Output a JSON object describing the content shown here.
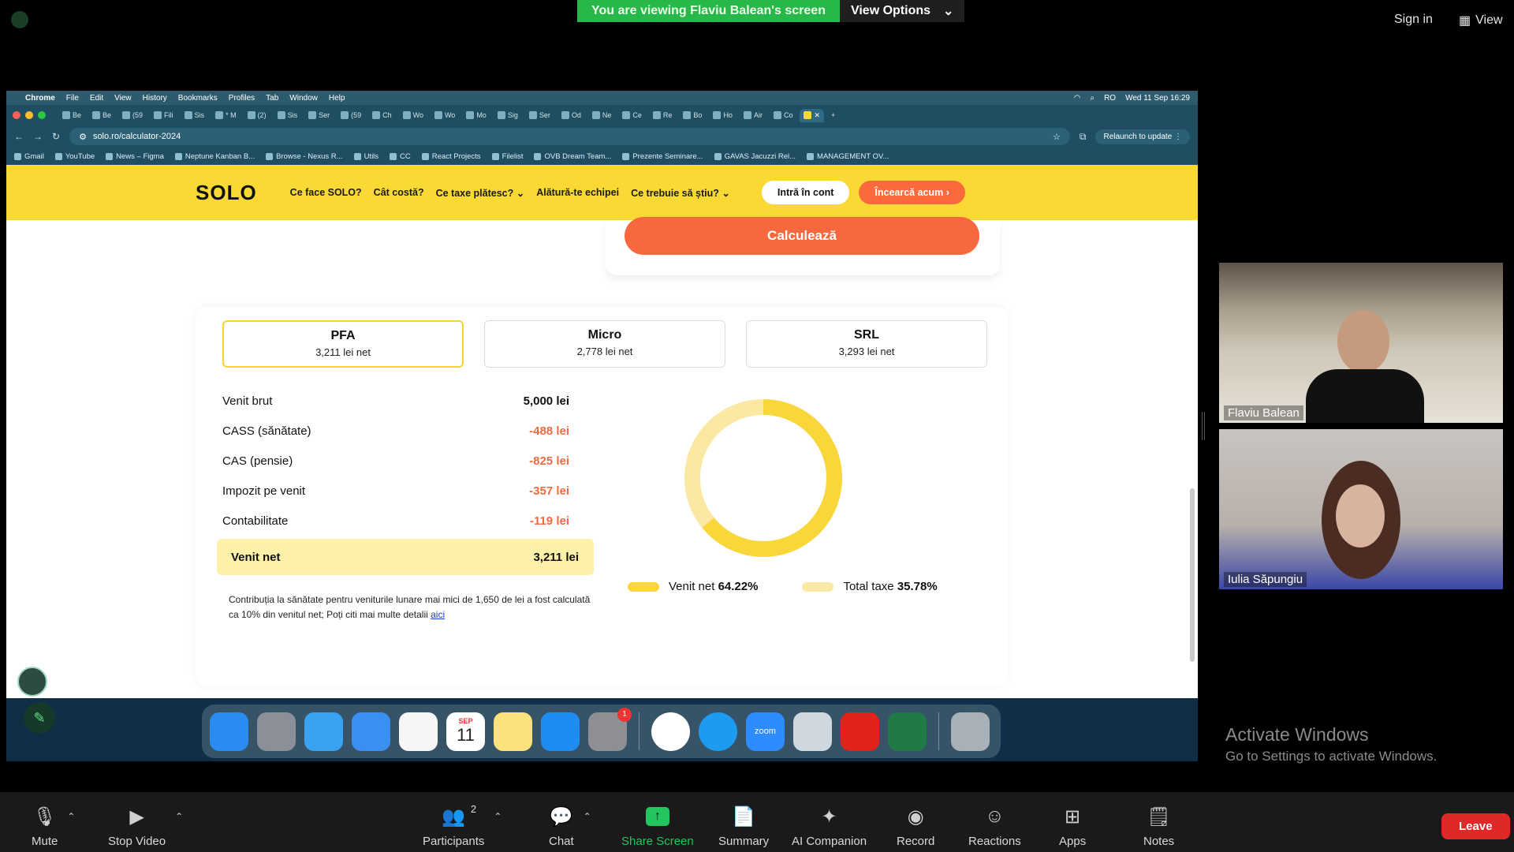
{
  "zoom": {
    "banner_text": "You are viewing Flaviu Balean's screen",
    "view_options": "View Options",
    "sign_in": "Sign in",
    "view": "View",
    "participants": [
      {
        "name": "Flaviu Balean"
      },
      {
        "name": "Iulia Săpungiu"
      }
    ],
    "activate_title": "Activate Windows",
    "activate_sub": "Go to Settings to activate Windows.",
    "toolbar": {
      "mute": "Mute",
      "stop_video": "Stop Video",
      "participants": "Participants",
      "participants_count": "2",
      "chat": "Chat",
      "share_screen": "Share Screen",
      "summary": "Summary",
      "ai_companion": "AI Companion",
      "record": "Record",
      "reactions": "Reactions",
      "apps": "Apps",
      "notes": "Notes",
      "leave": "Leave"
    }
  },
  "mac": {
    "menu": [
      "Chrome",
      "File",
      "Edit",
      "View",
      "History",
      "Bookmarks",
      "Profiles",
      "Tab",
      "Window",
      "Help"
    ],
    "clock": "Wed 11 Sep  16:29",
    "lang": "RO"
  },
  "chrome": {
    "tabs": [
      "Be",
      "Be",
      "(59",
      "Fili",
      "Sis",
      "* M",
      "(2)",
      "Sis",
      "Ser",
      "(59",
      "Ch",
      "Wo",
      "Wo",
      "Mo",
      "Sig",
      "Ser",
      "Od",
      "Ne",
      "Ce",
      "Re",
      "Bo",
      "Ho",
      "Air",
      "Co"
    ],
    "url": "solo.ro/calculator-2024",
    "relaunch": "Relaunch to update",
    "bookmarks": [
      "Gmail",
      "YouTube",
      "News – Figma",
      "Neptune Kanban B...",
      "Browse - Nexus R...",
      "Utils",
      "CC",
      "React Projects",
      "Filelist",
      "OVB Dream Team...",
      "Prezente Seminare...",
      "GAVAS Jacuzzi Rel...",
      "MANAGEMENT OV..."
    ]
  },
  "site": {
    "logo": "SOLO",
    "menu": [
      "Ce face SOLO?",
      "Cât costă?",
      "Ce taxe plătesc? ⌄",
      "Alătură-te echipei",
      "Ce trebuie să știu? ⌄"
    ],
    "login": "Intră în cont",
    "try": "Încearcă acum ›",
    "calculate": "Calculează",
    "options": [
      {
        "title": "PFA",
        "sub": "3,211 lei net"
      },
      {
        "title": "Micro",
        "sub": "2,778 lei net"
      },
      {
        "title": "SRL",
        "sub": "3,293 lei net"
      }
    ],
    "rows": [
      {
        "label": "Venit brut",
        "value": "5,000 lei"
      },
      {
        "label": "CASS (sănătate)",
        "value": "-488 lei"
      },
      {
        "label": "CAS (pensie)",
        "value": "-825 lei"
      },
      {
        "label": "Impozit pe venit",
        "value": "-357 lei"
      },
      {
        "label": "Contabilitate",
        "value": "-119 lei"
      }
    ],
    "net_label": "Venit net",
    "net_value": "3,211 lei",
    "note_text": "Contribuția la sănătate pentru veniturile lunare mai mici de 1,650 de lei a fost calculată ca 10% din venitul net; Poți citi mai multe detalii ",
    "note_link": "aici",
    "legend": [
      {
        "label": "Venit net ",
        "pct": "64.22%",
        "color": "#f9d63a"
      },
      {
        "label": "Total taxe ",
        "pct": "35.78%",
        "color": "#fbe9a3"
      }
    ]
  },
  "chart_data": {
    "type": "pie",
    "categories": [
      "Venit net",
      "Total taxe"
    ],
    "values": [
      64.22,
      35.78
    ],
    "colors": [
      "#f9d63a",
      "#fbe9a3"
    ]
  },
  "dock": {
    "calendar_month": "SEP",
    "calendar_day": "11",
    "settings_badge": "1",
    "zoom_label": "zoom"
  }
}
